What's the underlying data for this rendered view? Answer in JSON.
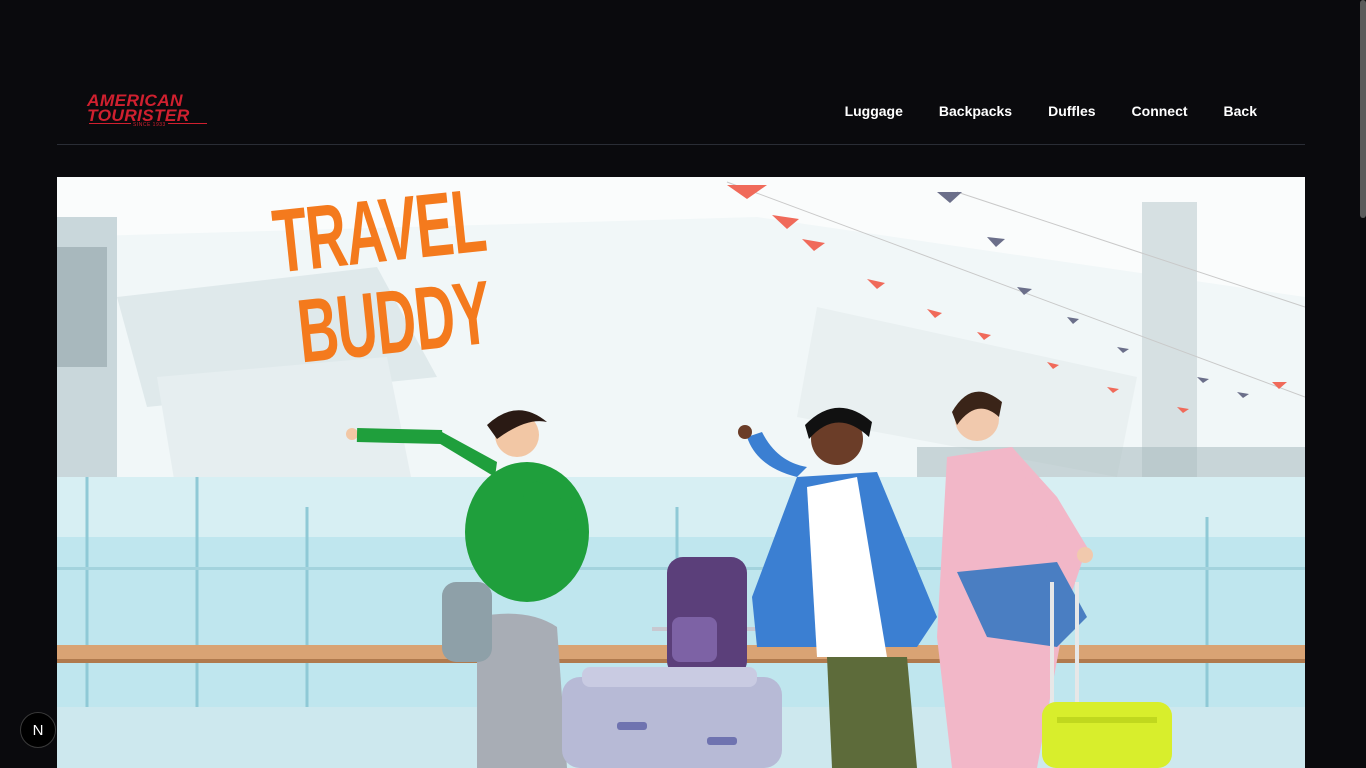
{
  "brand": {
    "name_line1": "AMERICAN",
    "name_line2": "TOURISTER",
    "since": "SINCE 1933",
    "color": "#d0202f"
  },
  "nav": {
    "items": [
      {
        "label": "Luggage"
      },
      {
        "label": "Backpacks"
      },
      {
        "label": "Duffles"
      },
      {
        "label": "Connect"
      },
      {
        "label": "Back"
      }
    ]
  },
  "hero": {
    "title_line1": "TRAVEL",
    "title_line2": "BUDDY",
    "title_color": "#f47a1d"
  },
  "dev_badge": {
    "label": "N"
  }
}
